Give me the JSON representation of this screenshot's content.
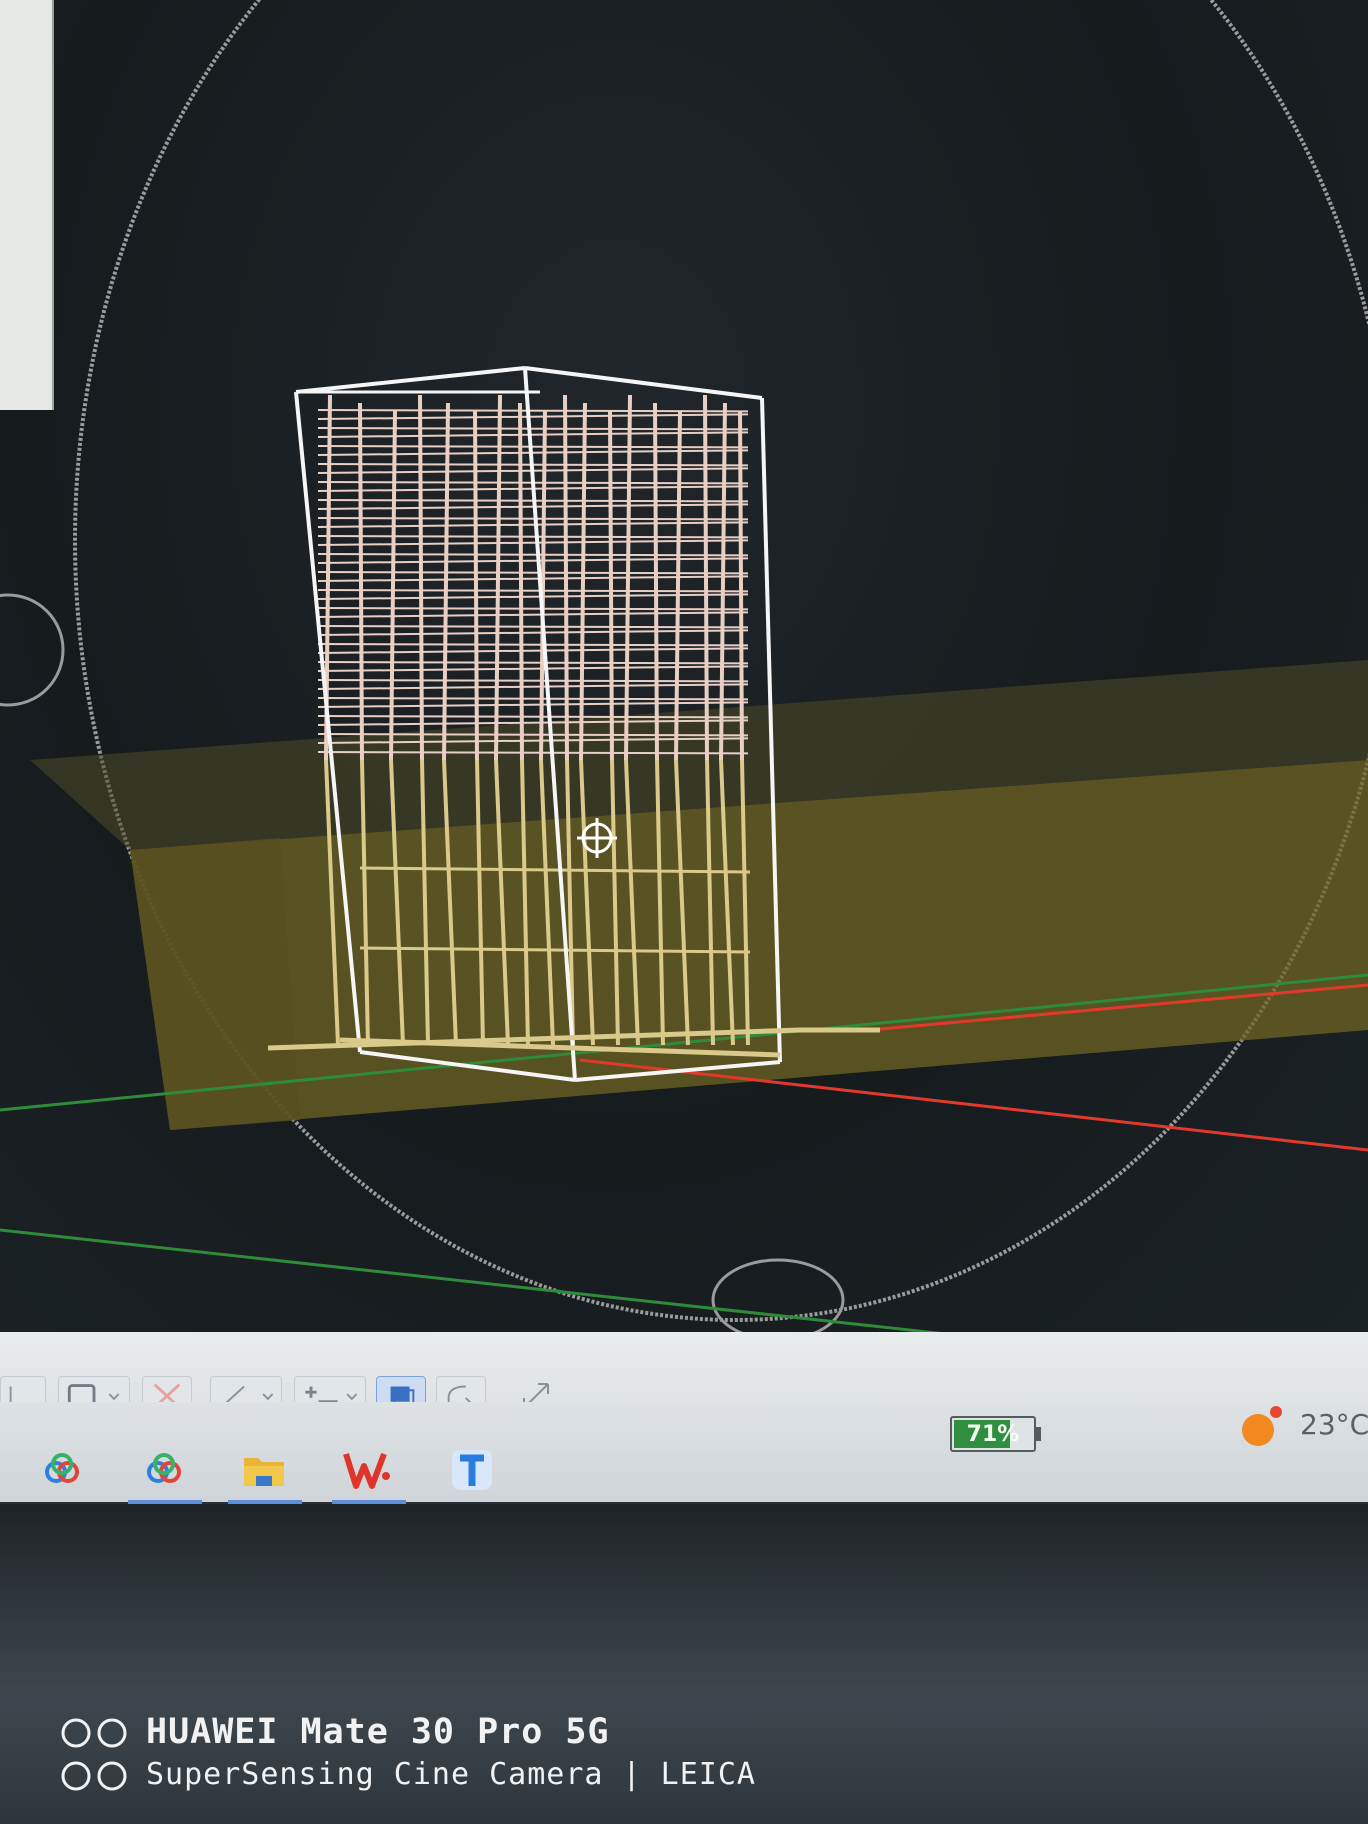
{
  "viewport": {
    "description_icons": [
      "orbit-circle-icon",
      "pan-cursor-icon",
      "x-axis",
      "y-axis"
    ],
    "colors": {
      "background": "#161b1e",
      "slab": "#8a7c2c",
      "rebar_light": "#e8cfc4",
      "rebar_gold": "#d9c98a",
      "x_axis": "#e23a2a",
      "y_axis": "#2e8b3a",
      "orbit": "#a7a7a7"
    }
  },
  "toolbar": {
    "tools": [
      "ortho-tool",
      "rectangle-select-tool",
      "delete-tool",
      "angle-tool",
      "dimension-tool",
      "layer-tool",
      "polar-tool",
      "fullscreen-tool"
    ]
  },
  "taskbar": {
    "apps": [
      "cloud-app",
      "cloud-app-2",
      "file-explorer-app",
      "wps-app",
      "text-app"
    ]
  },
  "system_tray": {
    "battery_percent": "71%",
    "battery_level": 0.71,
    "temperature": "23°C"
  },
  "watermark": {
    "line1": "HUAWEI Mate 30 Pro 5G",
    "line2": "SuperSensing Cine Camera | LEICA"
  }
}
